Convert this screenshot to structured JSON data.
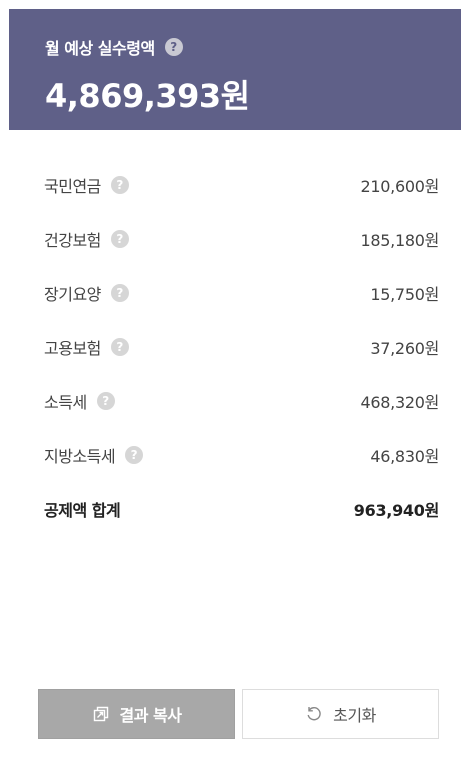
{
  "header": {
    "label": "월 예상 실수령액",
    "help_icon": "?",
    "amount": "4,869,393원"
  },
  "deductions": [
    {
      "label": "국민연금",
      "value": "210,600원",
      "help_icon": "?"
    },
    {
      "label": "건강보험",
      "value": "185,180원",
      "help_icon": "?"
    },
    {
      "label": "장기요양",
      "value": "15,750원",
      "help_icon": "?"
    },
    {
      "label": "고용보험",
      "value": "37,260원",
      "help_icon": "?"
    },
    {
      "label": "소득세",
      "value": "468,320원",
      "help_icon": "?"
    },
    {
      "label": "지방소득세",
      "value": "46,830원",
      "help_icon": "?"
    }
  ],
  "total": {
    "label": "공제액 합계",
    "value": "963,940원"
  },
  "buttons": {
    "copy_label": "결과 복사",
    "copy_icon": "copy-icon",
    "reset_label": "초기화",
    "reset_icon": "reset-icon"
  },
  "colors": {
    "header_bg": "#5f6088",
    "copy_button_bg": "#a8a8a8",
    "help_icon_bg": "#d6d6d6"
  }
}
